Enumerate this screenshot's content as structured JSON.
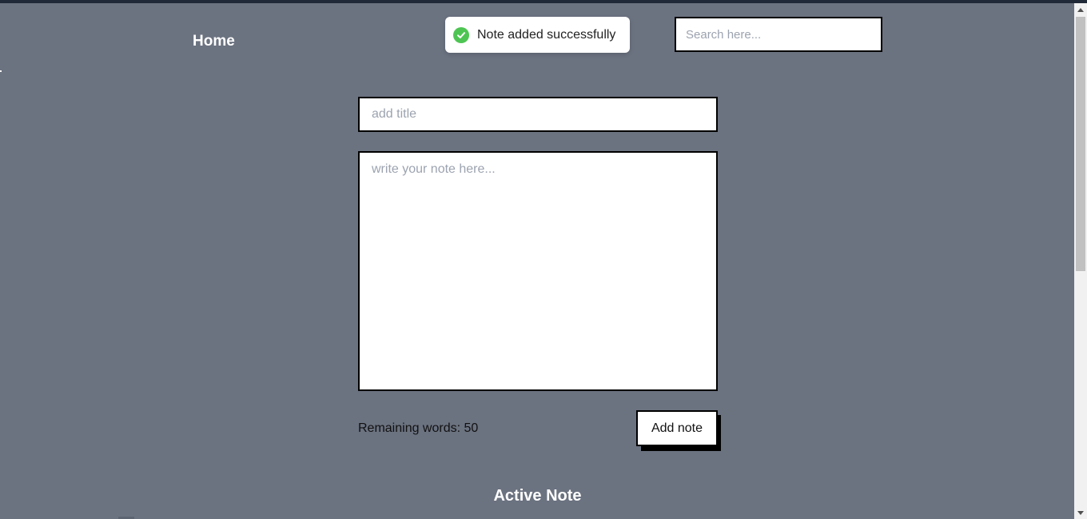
{
  "nav": {
    "home_label": "Home"
  },
  "toast": {
    "message": "Note added successfully",
    "icon": "check-circle-icon",
    "color": "#4ec553"
  },
  "search": {
    "placeholder": "Search here...",
    "value": ""
  },
  "form": {
    "title_placeholder": "add title",
    "title_value": "",
    "note_placeholder": "write your note here...",
    "note_value": "",
    "remaining_label": "Remaining words: 50",
    "add_button_label": "Add note"
  },
  "section": {
    "active_heading": "Active Note"
  },
  "colors": {
    "background": "#6b7280",
    "success": "#4ec553"
  }
}
